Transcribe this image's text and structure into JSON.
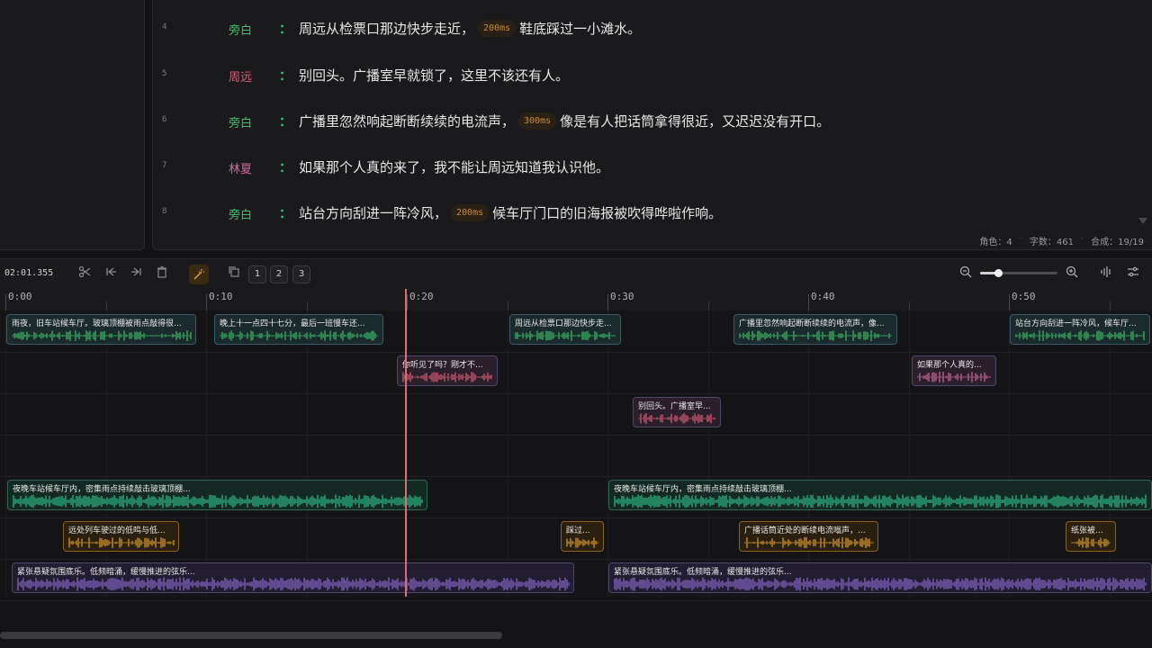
{
  "script": {
    "lines": [
      {
        "num": "4",
        "speaker": "旁白",
        "speaker_color": "#3fbf6a",
        "pre": "周远从检票口那边快步走近，",
        "pause": "200ms",
        "post": "鞋底踩过一小滩水。"
      },
      {
        "num": "5",
        "speaker": "周远",
        "speaker_color": "#d9607a",
        "pre": "别回头。广播室早就锁了，这里不该还有人。",
        "pause": "",
        "post": ""
      },
      {
        "num": "6",
        "speaker": "旁白",
        "speaker_color": "#3fbf6a",
        "pre": "广播里忽然响起断断续续的电流声，",
        "pause": "300ms",
        "post": "像是有人把话筒拿得很近，又迟迟没有开口。"
      },
      {
        "num": "7",
        "speaker": "林夏",
        "speaker_color": "#d06aa0",
        "pre": "如果那个人真的来了，我不能让周远知道我认识他。",
        "pause": "",
        "post": ""
      },
      {
        "num": "8",
        "speaker": "旁白",
        "speaker_color": "#3fbf6a",
        "pre": "站台方向刮进一阵冷风，",
        "pause": "200ms",
        "post": "候车厅门口的旧海报被吹得哗啦作响。"
      }
    ],
    "colon": "："
  },
  "stats": {
    "roles": "角色：4",
    "chars": "字数：461",
    "synth": "合成：19/19"
  },
  "toolbar": {
    "time": "02:01.355",
    "track_buttons": [
      "1",
      "2",
      "3"
    ],
    "zoom_level": 0.23
  },
  "ruler": {
    "labels": [
      "0:00",
      "0:10",
      "0:20",
      "0:30",
      "0:40",
      "0:50"
    ]
  },
  "clips": [
    {
      "row": 0,
      "color": "green",
      "label": "雨夜，旧车站候车厅。玻璃顶棚被雨点敲得很...",
      "wave": "#3fbf6a"
    },
    {
      "row": 0,
      "color": "green",
      "label": "晚上十一点四十七分，最后一班慢车还...",
      "wave": "#3fbf6a"
    },
    {
      "row": 0,
      "color": "green",
      "label": "周远从检票口那边快步走...",
      "wave": "#3fbf6a"
    },
    {
      "row": 0,
      "color": "green",
      "label": "广播里忽然响起断断续续的电流声，像...",
      "wave": "#3fbf6a"
    },
    {
      "row": 0,
      "color": "green",
      "label": "站台方向刮进一阵冷风，候车厅...",
      "wave": "#3fbf6a"
    },
    {
      "row": 1,
      "color": "pink",
      "label": "你听见了吗？刚才不...",
      "wave": "#d9607a"
    },
    {
      "row": 1,
      "color": "pink",
      "label": "如果那个人真的...",
      "wave": "#d06aa0"
    },
    {
      "row": 2,
      "color": "pink",
      "label": "别回头。广播室早...",
      "wave": "#d9607a"
    },
    {
      "row": 4,
      "color": "teal",
      "label": "夜晚车站候车厅内，密集雨点持续敲击玻璃顶棚...",
      "wave": "#2fbf8a"
    },
    {
      "row": 4,
      "color": "teal",
      "label": "夜晚车站候车厅内，密集雨点持续敲击玻璃顶棚...",
      "wave": "#2fbf8a"
    },
    {
      "row": 5,
      "color": "orange",
      "label": "远处列车驶过的低鸣与低...",
      "wave": "#e0a030"
    },
    {
      "row": 5,
      "color": "orange",
      "label": "踩过...",
      "wave": "#e0a030"
    },
    {
      "row": 5,
      "color": "orange",
      "label": "广播话筒近处的断续电流嗡声，...",
      "wave": "#e0a030"
    },
    {
      "row": 5,
      "color": "orange",
      "label": "纸张被...",
      "wave": "#e0a030"
    },
    {
      "row": 6,
      "color": "purple",
      "label": "紧张悬疑氛围底乐。低频暗涌，缓慢推进的弦乐...",
      "wave": "#8a6ad0"
    },
    {
      "row": 6,
      "color": "purple",
      "label": "紧张悬疑氛围底乐。低频暗涌，缓慢推进的弦乐...",
      "wave": "#8a6ad0"
    }
  ]
}
